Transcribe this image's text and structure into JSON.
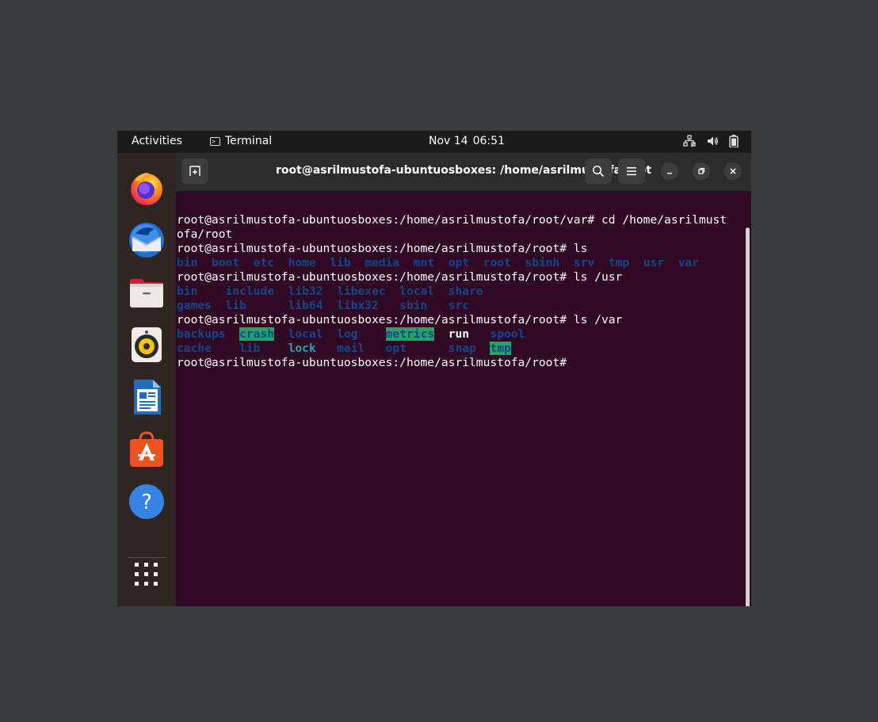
{
  "topbar": {
    "activities": "Activities",
    "app_menu_label": "Terminal",
    "clock_date": "Nov 14",
    "clock_time": "06:51"
  },
  "dock": {
    "apps": [
      {
        "name": "Firefox",
        "icon": "firefox-icon"
      },
      {
        "name": "Thunderbird",
        "icon": "thunderbird-icon"
      },
      {
        "name": "Files",
        "icon": "files-icon"
      },
      {
        "name": "Rhythmbox",
        "icon": "rhythmbox-icon"
      },
      {
        "name": "LibreOffice Writer",
        "icon": "writer-icon"
      },
      {
        "name": "Ubuntu Software",
        "icon": "software-icon"
      },
      {
        "name": "Help",
        "icon": "help-icon"
      }
    ],
    "show_apps_icon": "app-grid-icon"
  },
  "window": {
    "title": "root@asrilmustofa-ubuntuosboxes: /home/asrilmustofa/root"
  },
  "terminal": {
    "colors": {
      "background": "#300a24",
      "dir": "#12488b",
      "sticky_bg": "#26a269",
      "symlink": "#2aa1b3"
    },
    "lines": [
      {
        "segments": [
          {
            "text": "root@asrilmustofa-ubuntuosboxes:/home/asrilmustofa/root/var# cd /home/asrilmust",
            "style": "p"
          }
        ]
      },
      {
        "segments": [
          {
            "text": "ofa/root",
            "style": "p"
          }
        ]
      },
      {
        "segments": [
          {
            "text": "root@asrilmustofa-ubuntuosboxes:/home/asrilmustofa/root# ls",
            "style": "p"
          }
        ]
      },
      {
        "segments": [
          {
            "text": "bin",
            "style": "d"
          },
          {
            "text": "  ",
            "style": "p"
          },
          {
            "text": "boot",
            "style": "d"
          },
          {
            "text": "  ",
            "style": "p"
          },
          {
            "text": "etc",
            "style": "d"
          },
          {
            "text": "  ",
            "style": "p"
          },
          {
            "text": "home",
            "style": "d"
          },
          {
            "text": "  ",
            "style": "p"
          },
          {
            "text": "lib",
            "style": "d"
          },
          {
            "text": "  ",
            "style": "p"
          },
          {
            "text": "media",
            "style": "d"
          },
          {
            "text": "  ",
            "style": "p"
          },
          {
            "text": "mnt",
            "style": "d"
          },
          {
            "text": "  ",
            "style": "p"
          },
          {
            "text": "opt",
            "style": "d"
          },
          {
            "text": "  ",
            "style": "p"
          },
          {
            "text": "root",
            "style": "d"
          },
          {
            "text": "  ",
            "style": "p"
          },
          {
            "text": "sbinh",
            "style": "d"
          },
          {
            "text": "  ",
            "style": "p"
          },
          {
            "text": "srv",
            "style": "d"
          },
          {
            "text": "  ",
            "style": "p"
          },
          {
            "text": "tmp",
            "style": "d"
          },
          {
            "text": "  ",
            "style": "p"
          },
          {
            "text": "usr",
            "style": "d"
          },
          {
            "text": "  ",
            "style": "p"
          },
          {
            "text": "var",
            "style": "d"
          }
        ]
      },
      {
        "segments": [
          {
            "text": "root@asrilmustofa-ubuntuosboxes:/home/asrilmustofa/root# ls /usr",
            "style": "p"
          }
        ]
      },
      {
        "segments": [
          {
            "text": "bin",
            "style": "d"
          },
          {
            "text": "    ",
            "style": "p"
          },
          {
            "text": "include",
            "style": "d"
          },
          {
            "text": "  ",
            "style": "p"
          },
          {
            "text": "lib32",
            "style": "d"
          },
          {
            "text": "  ",
            "style": "p"
          },
          {
            "text": "libexec",
            "style": "d"
          },
          {
            "text": "  ",
            "style": "p"
          },
          {
            "text": "local",
            "style": "d"
          },
          {
            "text": "  ",
            "style": "p"
          },
          {
            "text": "share",
            "style": "d"
          }
        ]
      },
      {
        "segments": [
          {
            "text": "games",
            "style": "d"
          },
          {
            "text": "  ",
            "style": "p"
          },
          {
            "text": "lib",
            "style": "d"
          },
          {
            "text": "      ",
            "style": "p"
          },
          {
            "text": "lib64",
            "style": "d"
          },
          {
            "text": "  ",
            "style": "p"
          },
          {
            "text": "libx32",
            "style": "d"
          },
          {
            "text": "   ",
            "style": "p"
          },
          {
            "text": "sbin",
            "style": "d"
          },
          {
            "text": "   ",
            "style": "p"
          },
          {
            "text": "src",
            "style": "d"
          }
        ]
      },
      {
        "segments": [
          {
            "text": "root@asrilmustofa-ubuntuosboxes:/home/asrilmustofa/root# ls /var",
            "style": "p"
          }
        ]
      },
      {
        "segments": [
          {
            "text": "backups",
            "style": "d"
          },
          {
            "text": "  ",
            "style": "p"
          },
          {
            "text": "crash",
            "style": "hl"
          },
          {
            "text": "  ",
            "style": "p"
          },
          {
            "text": "local",
            "style": "d"
          },
          {
            "text": "  ",
            "style": "p"
          },
          {
            "text": "log",
            "style": "d"
          },
          {
            "text": "    ",
            "style": "p"
          },
          {
            "text": "metrics",
            "style": "hl"
          },
          {
            "text": "  ",
            "style": "p"
          },
          {
            "text": "run",
            "style": "ww"
          },
          {
            "text": "   ",
            "style": "p"
          },
          {
            "text": "spool",
            "style": "d"
          }
        ]
      },
      {
        "segments": [
          {
            "text": "cache",
            "style": "d"
          },
          {
            "text": "    ",
            "style": "p"
          },
          {
            "text": "lib",
            "style": "d"
          },
          {
            "text": "    ",
            "style": "p"
          },
          {
            "text": "lock",
            "style": "sd"
          },
          {
            "text": "   ",
            "style": "p"
          },
          {
            "text": "mail",
            "style": "d"
          },
          {
            "text": "   ",
            "style": "p"
          },
          {
            "text": "opt",
            "style": "d"
          },
          {
            "text": "      ",
            "style": "p"
          },
          {
            "text": "snap",
            "style": "d"
          },
          {
            "text": "  ",
            "style": "p"
          },
          {
            "text": "tmp",
            "style": "hl"
          }
        ]
      },
      {
        "segments": [
          {
            "text": "root@asrilmustofa-ubuntuosboxes:/home/asrilmustofa/root# ",
            "style": "p"
          }
        ]
      }
    ]
  }
}
